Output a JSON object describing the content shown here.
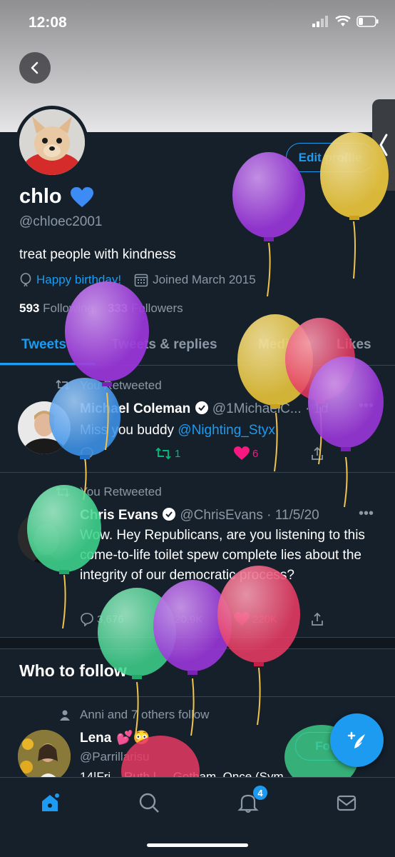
{
  "status_bar": {
    "time": "12:08"
  },
  "profile": {
    "name": "chlo",
    "handle": "@chloec2001",
    "bio": "treat people with kindness",
    "birthday": "Happy birthday!",
    "joined": "Joined March 2015",
    "following_count": "593",
    "following_label": "Following",
    "followers_count": "333",
    "followers_label": "Followers",
    "edit_label": "Edit profile"
  },
  "tabs": [
    "Tweets",
    "Tweets & replies",
    "Media",
    "Likes"
  ],
  "tweets": [
    {
      "retweeted_label": "You Retweeted",
      "name": "Michael Coleman",
      "handle": "@1MichaelC...",
      "time": "· 1d",
      "text_plain": "Miss you buddy ",
      "text_mention": "@Nighting_Styx",
      "retweets": "1",
      "likes": "6"
    },
    {
      "retweeted_label": "You Retweeted",
      "name": "Chris Evans",
      "handle": "@ChrisEvans",
      "time": "· 11/5/20",
      "text": "Wow. Hey Republicans, are you listening to this come-to-life toilet spew complete lies about the integrity of our democratic process?",
      "replies": "3,676",
      "retweets": "20.9K",
      "likes": "220K"
    }
  ],
  "who_to_follow": {
    "title": "Who to follow",
    "social_context": "Anni and 7 others follow",
    "name": "Lena",
    "handle": "@Parrillarisu",
    "bio": "14|Fri... Ruth | ... Gotham, Once (Sym...",
    "follow_label": "Follow"
  },
  "bottom_nav": {
    "notifications_badge": "4"
  },
  "colors": {
    "background": "#15202b",
    "accent": "#1d9bf0",
    "muted": "#8b98a5",
    "like": "#f91880",
    "retweet": "#00ba7c"
  },
  "icons": [
    "back-arrow-icon",
    "calendar-icon",
    "balloon-icon",
    "retweet-icon",
    "verified-icon",
    "heart-icon",
    "reply-icon",
    "share-icon",
    "person-icon",
    "compose-icon",
    "home-icon",
    "search-icon",
    "bell-icon",
    "mail-icon"
  ]
}
